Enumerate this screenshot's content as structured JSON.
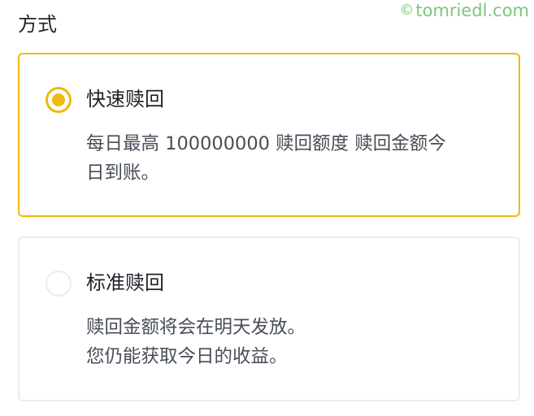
{
  "section": {
    "title": "方式"
  },
  "watermark": {
    "icon": "copyright-icon",
    "icon_glyph": "©",
    "text": "tomriedl.com"
  },
  "colors": {
    "accent": "#f0b90b",
    "border_unselected": "#eaecef",
    "text_primary": "#1e2329",
    "text_secondary": "#474d57",
    "watermark": "#7ec77a"
  },
  "options": [
    {
      "title": "快速赎回",
      "selected": true,
      "description_lines": [
        "每日最高 100000000 赎回额度 赎回金额今",
        "日到账。"
      ]
    },
    {
      "title": "标准赎回",
      "selected": false,
      "description_lines": [
        "赎回金额将会在明天发放。",
        "您仍能获取今日的收益。"
      ]
    }
  ]
}
